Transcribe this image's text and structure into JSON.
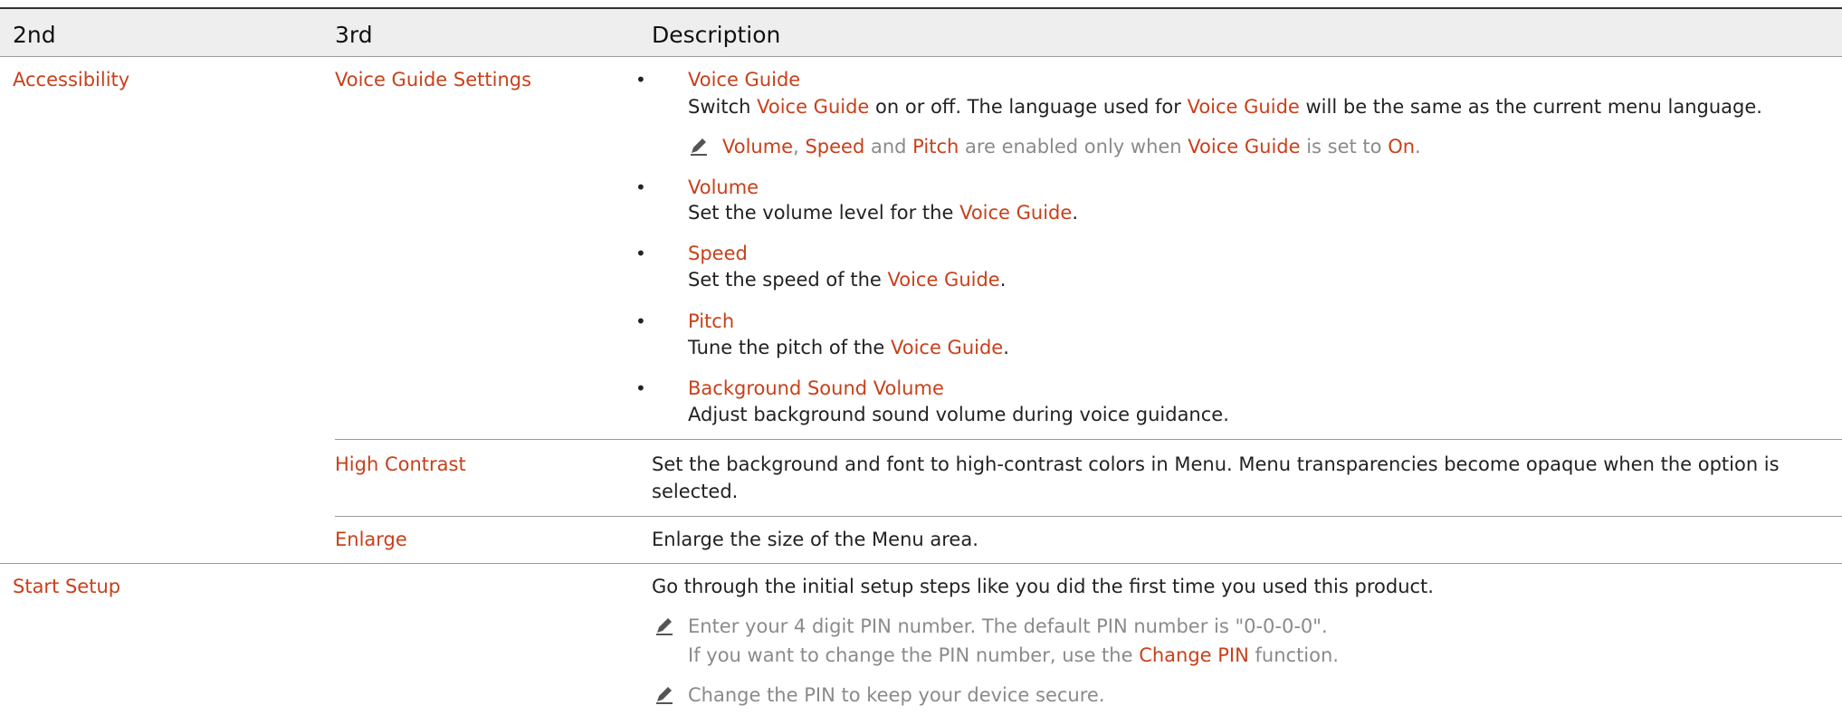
{
  "header": {
    "col1": "2nd",
    "col2": "3rd",
    "col3": "Description"
  },
  "rows": {
    "accessibility": {
      "label": "Accessibility",
      "voice_guide_settings": {
        "label": "Voice Guide Settings",
        "voice_guide": {
          "title": "Voice Guide",
          "desc_a": "Switch ",
          "desc_b": "Voice Guide",
          "desc_c": " on or off. The language used for ",
          "desc_d": "Voice Guide",
          "desc_e": " will be the same as the current menu language."
        },
        "note": {
          "a": "Volume",
          "b": ", ",
          "c": "Speed",
          "d": " and ",
          "e": "Pitch",
          "f": " are enabled only when ",
          "g": "Voice Guide",
          "h": " is set to ",
          "i": "On",
          "j": "."
        },
        "volume": {
          "title": "Volume",
          "desc_a": "Set the volume level for the ",
          "desc_b": "Voice Guide",
          "desc_c": "."
        },
        "speed": {
          "title": "Speed",
          "desc_a": "Set the speed of the ",
          "desc_b": "Voice Guide",
          "desc_c": "."
        },
        "pitch": {
          "title": "Pitch",
          "desc_a": "Tune the pitch of the ",
          "desc_b": "Voice Guide",
          "desc_c": "."
        },
        "background": {
          "title": "Background Sound Volume",
          "desc": "Adjust background sound volume during voice guidance."
        }
      },
      "high_contrast": {
        "label": "High Contrast",
        "desc_line1": "Set the background and font to high-contrast colors in Menu. Menu transparencies become opaque when the option is",
        "desc_line2": "selected."
      },
      "enlarge": {
        "label": "Enlarge",
        "desc": "Enlarge the size of the Menu area."
      }
    },
    "start_setup": {
      "label": "Start Setup",
      "desc": "Go through the initial setup steps like you did the first time you used this product.",
      "note1_line1": "Enter your 4 digit PIN number. The default PIN number is \"0-0-0-0\".",
      "note1_line2_a": "If you want to change the PIN number, use the ",
      "note1_line2_b": "Change PIN",
      "note1_line2_c": " function.",
      "note2": "Change the PIN to keep your device secure."
    }
  },
  "colors": {
    "accent": "#c8401a",
    "note_text": "#8a8a8a",
    "header_bg": "#eeeeee"
  },
  "icons": {
    "note": "pencil-note-icon",
    "bullet": "bullet-dot"
  }
}
